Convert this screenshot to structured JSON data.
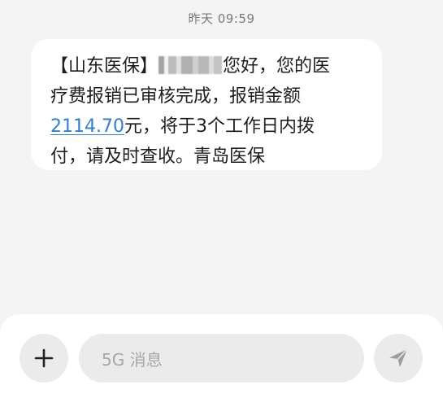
{
  "conversation": {
    "timestamp": "昨天 09:59"
  },
  "message": {
    "line1_prefix": "【山东医保】",
    "line1_suffix": "您好，您的医",
    "line2": "疗费报销已审核完成，报销金额",
    "amount": "2114.70",
    "line3_suffix": "元，将于3个工作日内拨",
    "line4": "付，请及时查收。青岛医保"
  },
  "composer": {
    "placeholder": "5G 消息",
    "plus_icon": "plus-icon",
    "send_icon": "send-icon"
  },
  "colors": {
    "background": "#f4f4f4",
    "bubble": "#ffffff",
    "link": "#2f7fd6",
    "text": "#1e1e1e",
    "muted": "#7a7a7a"
  }
}
